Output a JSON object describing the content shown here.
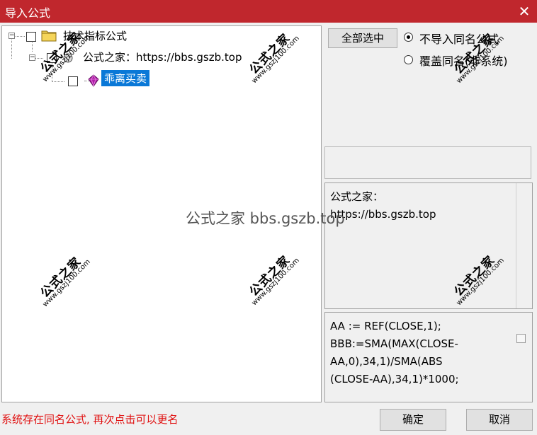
{
  "window": {
    "title": "导入公式",
    "close_glyph": "✕"
  },
  "tree": {
    "root_label": "技术指标公式",
    "group_label": "公式之家：https://bbs.gszb.top",
    "item_label": "乖离买卖",
    "expander_glyph": "−"
  },
  "options": {
    "select_all_label": "全部选中",
    "radio_skip_label": "不导入同名公式",
    "radio_overwrite_label": "覆盖同名(非系统)",
    "selected_option": "skip"
  },
  "description": {
    "line1": "公式之家：",
    "line2": "https://bbs.gszb.top"
  },
  "formula": {
    "source": "AA := REF(CLOSE,1);\nBBB:=SMA(MAX(CLOSE-\nAA,0),34,1)/SMA(ABS\n(CLOSE-AA),34,1)*1000;"
  },
  "status": {
    "message": "系统存在同名公式, 再次点击可以更名"
  },
  "buttons": {
    "ok_label": "确定",
    "cancel_label": "取消"
  },
  "watermark": {
    "title": "公式之家",
    "url": "www.gszj100.com",
    "center_text": "公式之家 bbs.gszb.top"
  },
  "colors": {
    "titlebar": "#c0272d",
    "selection": "#0a78d7",
    "status_text": "#e01010"
  }
}
